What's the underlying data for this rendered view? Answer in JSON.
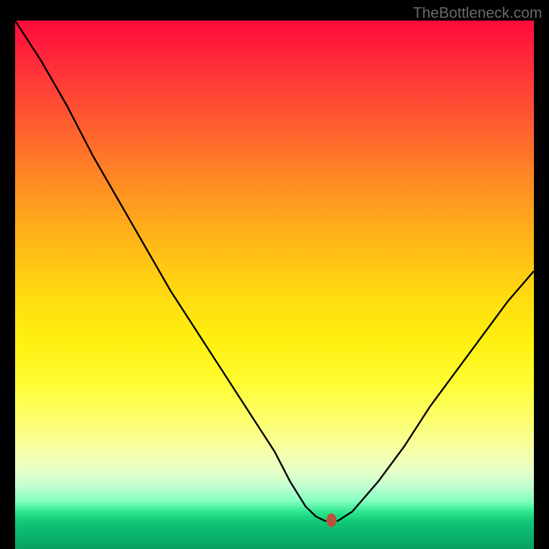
{
  "watermark": "TheBottleneck.com",
  "chart_data": {
    "type": "line",
    "title": "",
    "xlabel": "",
    "ylabel": "",
    "xlim": [
      0,
      100
    ],
    "ylim": [
      0,
      100
    ],
    "background_gradient": {
      "top": "#ff0a3c",
      "mid": "#fff010",
      "bottom": "#10c878"
    },
    "series": [
      {
        "name": "bottleneck-curve",
        "color": "#000000",
        "x": [
          0,
          5,
          10,
          15,
          20,
          25,
          30,
          35,
          40,
          45,
          50,
          53,
          56,
          58,
          60,
          62,
          65,
          70,
          75,
          80,
          85,
          90,
          95,
          100
        ],
        "values": [
          100,
          92,
          83,
          73,
          64,
          55,
          46,
          38,
          30,
          22,
          14,
          8,
          3,
          1,
          0,
          0,
          2,
          8,
          15,
          23,
          30,
          37,
          44,
          50
        ]
      }
    ],
    "marker": {
      "x": 61,
      "y": 0,
      "color": "#bf4f3a"
    }
  }
}
